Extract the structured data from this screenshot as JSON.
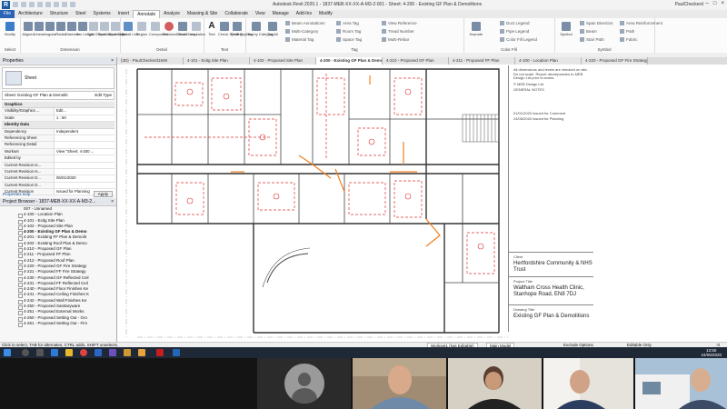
{
  "titlebar": {
    "title": "Autodesk Revit 2020.1 - 1837-MEB-XX-XX-A-M3-2-001 - Sheet: 4-200 - Existing GF Plan & Demolitions",
    "user": "PaulCheckerd",
    "minimize": "–",
    "maximize": "□",
    "close": "×"
  },
  "ribbon_tabs": [
    "File",
    "Architecture",
    "Structure",
    "Steel",
    "Systems",
    "Insert",
    "Annotate",
    "Analyze",
    "Massing & Site",
    "Collaborate",
    "View",
    "Manage",
    "Add-Ins",
    "Modify"
  ],
  "ribbon_active_tab": "Annotate",
  "ribbon": {
    "select_group": "Select",
    "modify": "Modify",
    "dimension_group": "Dimension",
    "dim_buttons": [
      "Aligned",
      "Linear",
      "Angular",
      "Radial",
      "Diameter",
      "Arc Length",
      "Spot Elevation",
      "Spot Coordinate",
      "Spot Slope"
    ],
    "detail_group": "Detail",
    "detail_buttons": [
      "Detail Line",
      "Region",
      "Component",
      "Revision Cloud",
      "Detail Group",
      "Insulation"
    ],
    "text_group": "Text",
    "text_buttons": [
      "Text",
      "Check Spelling",
      "Find/ Replace"
    ],
    "tag_group": "Tag",
    "tag_buttons": [
      "Tag by Category",
      "Tag All"
    ],
    "tag_items": [
      "Beam Annotations",
      "Multi-Category",
      "Material Tag",
      "Area Tag",
      "Room Tag",
      "Space Tag",
      "View Reference",
      "Tread Number",
      "Multi-Rebar"
    ],
    "color_fill_group": "Color Fill",
    "keynote": "Keynote",
    "color_items": [
      "Duct Legend",
      "Pipe Legend",
      "Color Fill Legend"
    ],
    "symbol_group": "Symbol",
    "symbol": "Symbol",
    "symbol_items": [
      "Span Direction",
      "Beam",
      "Stair Path",
      "Area Reinforcement",
      "Path",
      "Fabric"
    ]
  },
  "properties": {
    "title": "Properties",
    "type_name": "Sheet",
    "filter": "Sheet: Existing GF Plan & Demoliti",
    "edit_type": "Edit Type",
    "sections": [
      {
        "name": "Graphics",
        "rows": [
          {
            "k": "Visibility/Graphics ...",
            "v": "Edit..."
          },
          {
            "k": "Scale",
            "v": "1 : 50"
          }
        ]
      },
      {
        "name": "Identity Data",
        "rows": [
          {
            "k": "Dependency",
            "v": "Independent"
          },
          {
            "k": "Referencing Sheet",
            "v": ""
          },
          {
            "k": "Referencing Detail",
            "v": ""
          },
          {
            "k": "Workset",
            "v": "View \"Sheet: 4-200 ..."
          },
          {
            "k": "Edited by",
            "v": ""
          },
          {
            "k": "Current Revision Is...",
            "v": ""
          },
          {
            "k": "Current Revision Is...",
            "v": ""
          },
          {
            "k": "Current Revision D...",
            "v": "06/01/2020"
          },
          {
            "k": "Current Revision D...",
            "v": ""
          },
          {
            "k": "Current Revision",
            "v": "Issued for Planning"
          }
        ]
      }
    ],
    "help": "Properties help",
    "apply": "Apply"
  },
  "browser": {
    "title": "Project Browser - 1837-MEB-XX-XX-A-M3-2...",
    "items": [
      "007 - Unnamed",
      "4-100 - Location Plan",
      "4-101 - Exitg Site Plan",
      "4-102 - Proposed Site Plan",
      "4-200 - Existing GF Plan & Demo",
      "4-201 - Existing FF Plan & Demolit",
      "4-202 - Existing Roof Plan & Demo",
      "4-210 - Proposed GF Plan",
      "4-211 - Proposed FF Plan",
      "4-212 - Proposed Roof Plan",
      "4-220 - Proposed GF Fire Strategy",
      "4-221 - Proposed FF Fire Strategy",
      "4-230 - Proposed GF Reflected Ceil",
      "4-231 - Proposed FF Reflected Ceil",
      "4-240 - Proposed Floor Finishes Ke",
      "4-241 - Proposed Ceiling Finishes K",
      "4-242 - Proposed Wall Finishes Ke",
      "4-250 - Proposed Sanitaryware",
      "4-251 - Proposed External Works",
      "4-260 - Proposed Setting Out - Gro",
      "4-261 - Proposed Setting Out - Firs"
    ]
  },
  "view_tabs": [
    "{3D} - PaulCheckerd1949",
    "4-101 - Exitg Site Plan",
    "4-102 - Proposed Site Plan",
    "4-200 - Existing GF Plan & Demo...",
    "4-210 - Proposed GF Plan",
    "4-211 - Proposed FF Plan",
    "4-100 - Location Plan",
    "4-220 - Proposed GF Fire Strategy"
  ],
  "view_tab_active": 3,
  "titleblock": {
    "notes": "All dimensions and levels are checked on site. Do not scale. Report discrepancies to MEB Design Ltd prior to works.",
    "company": "© MEB Design Ltd",
    "general_notes": "GENERAL NOTES",
    "rev1": "01/01/2020   Issued for Comment",
    "rev2": "24/06/2020   Issued for Planning",
    "client": "Hertfordshire Community & NHS Trust",
    "project": "Waltham Cross Health Clinic, Stanhope Road, EN8 7DJ",
    "drawing": "Existing GF Plan & Demolitions",
    "client_label": "Client",
    "project_label": "Project Title",
    "drawing_label": "Drawing Title"
  },
  "statusbar": {
    "hint": "Click to select, TAB for alternates, CTRL adds, SHIFT unselects.",
    "workset": "Workset1 (Not Editable)",
    "model": "Main Model",
    "exclude": "Exclude Options",
    "editable": "Editable Only",
    "zoom": ":0"
  },
  "taskbar": {
    "time": "13:50",
    "date": "24/06/2020"
  },
  "colors": {
    "accent": "#2a64b4",
    "demolition_red": "#e03030",
    "annotation_orange": "#f08020",
    "wall": "#333333"
  }
}
